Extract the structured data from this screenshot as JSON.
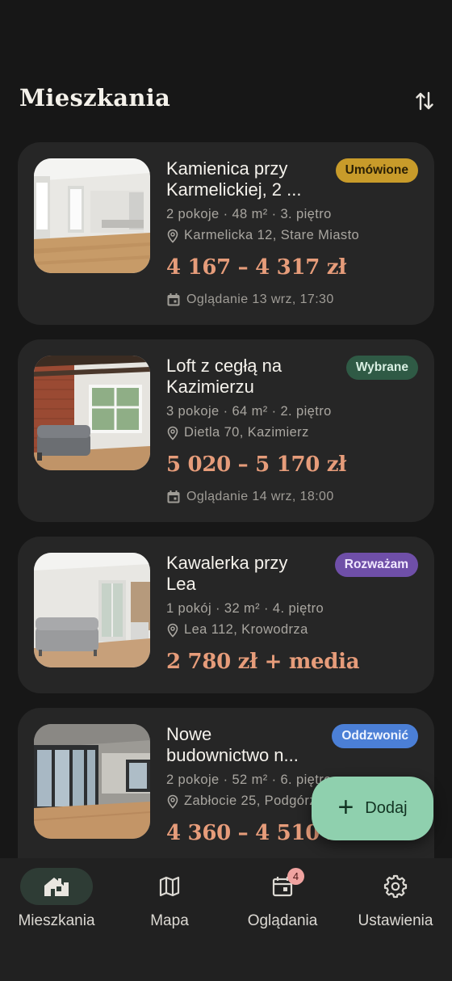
{
  "header": {
    "title": "Mieszkania"
  },
  "listings": [
    {
      "title_line1": "Kamienica przy",
      "title_line2": "Karmelickiej, 2 ...",
      "status": "Umówione",
      "status_color": "#c89b2a",
      "status_text_color": "#2a1f05",
      "meta": "2 pokoje · 48 m² · 3. piętro",
      "address": "Karmelicka 12, Stare Miasto",
      "price": "4 167 – 4 317 zł",
      "viewing": "Oglądanie 13 wrz, 17:30"
    },
    {
      "title_line1": "Loft z cegłą na",
      "title_line2": "Kazimierzu",
      "status": "Wybrane",
      "status_color": "#2f5a45",
      "status_text_color": "#d8efe2",
      "meta": "3 pokoje · 64 m² · 2. piętro",
      "address": "Dietla 70, Kazimierz",
      "price": "5 020 – 5 170 zł",
      "viewing": "Oglądanie 14 wrz, 18:00"
    },
    {
      "title_line1": "Kawalerka przy",
      "title_line2": "Lea",
      "status": "Rozważam",
      "status_color": "#6f4fa8",
      "status_text_color": "#f0e8ff",
      "meta": "1 pokój · 32 m² · 4. piętro",
      "address": "Lea 112, Krowodrza",
      "price": "2 780 zł + media"
    },
    {
      "title_line1": "Nowe",
      "title_line2": "budownictwo n...",
      "status": "Oddzwonić",
      "status_color": "#4b7fd6",
      "status_text_color": "#eef4ff",
      "meta": "2 pokoje · 52 m² · 6. piętro",
      "address": "Zabłocie 25, Podgórze",
      "price": "4 360 – 4 510 zł"
    }
  ],
  "fab": {
    "label": "Dodaj"
  },
  "nav": {
    "items": [
      {
        "label": "Mieszkania",
        "icon": "home-icon"
      },
      {
        "label": "Mapa",
        "icon": "map-icon"
      },
      {
        "label": "Oglądania",
        "icon": "calendar-icon",
        "badge": "4"
      },
      {
        "label": "Ustawienia",
        "icon": "gear-icon"
      }
    ]
  }
}
